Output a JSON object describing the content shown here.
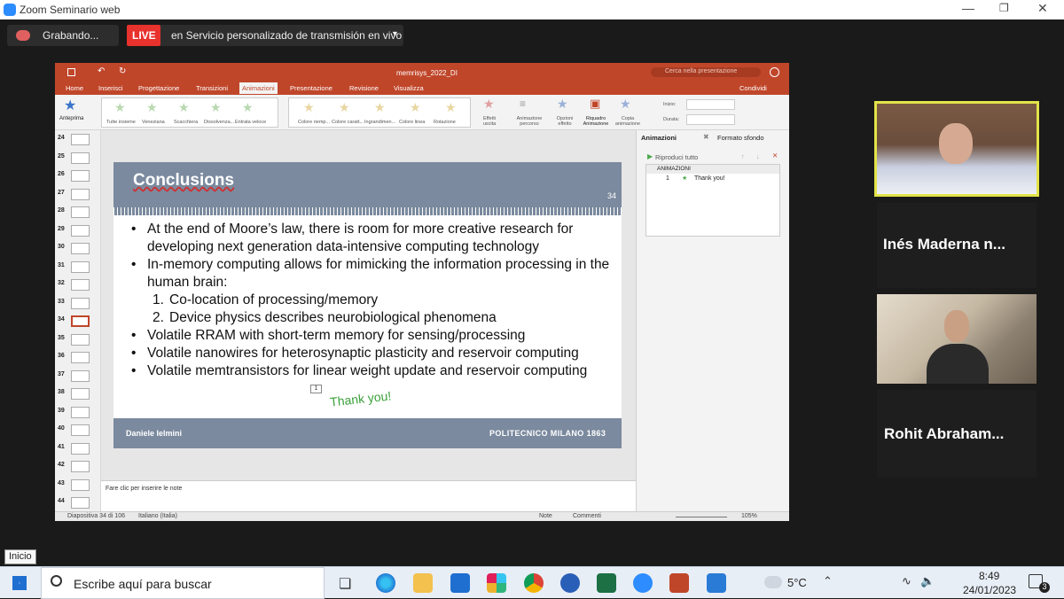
{
  "window": {
    "title": "Zoom Seminario web"
  },
  "zoom": {
    "recording": "Grabando...",
    "live_badge": "LIVE",
    "live_service": "en Servicio personalizado de transmisión en vivo"
  },
  "ppt": {
    "filename": "memrisys_2022_DI",
    "search_placeholder": "Cerca nella presentazione",
    "tabs": [
      "Home",
      "Inserisci",
      "Progettazione",
      "Transizioni",
      "Animazioni",
      "Presentazione",
      "Revisione",
      "Visualizza"
    ],
    "share": "Condividi",
    "ribbon": {
      "preview": "Anteprima",
      "effects": [
        "Tutte insieme",
        "Veneziana",
        "Scacchiera",
        "Dissolvenza...",
        "Entrata veloce"
      ],
      "emphasis": [
        "Colore riemp...",
        "Colore caratt...",
        "Ingrandimen...",
        "Colore linea",
        "Rotazione"
      ],
      "effect_opts": "Effetti uscita",
      "anim_path": "Animazione percorso",
      "options": "Opzioni effetto",
      "anim_pane": "Riquadro Animazione",
      "copy_anim": "Copia animazione",
      "start": "Inizio:",
      "duration": "Durata:"
    },
    "slide_numbers": [
      "24",
      "25",
      "26",
      "27",
      "28",
      "29",
      "30",
      "31",
      "32",
      "33",
      "34",
      "35",
      "36",
      "37",
      "38",
      "39",
      "40",
      "41",
      "42",
      "43",
      "44"
    ],
    "notes_placeholder": "Fare clic per inserire le note",
    "panel": {
      "tab1": "Animazioni",
      "tab2": "Formato sfondo",
      "play": "Riproduci tutto",
      "header": "ANIMAZIONI",
      "item_num": "1",
      "item_label": "Thank you!"
    },
    "status": {
      "slide": "Diapositiva 34 di 106",
      "lang": "Italiano (Italia)",
      "notes": "Note",
      "comments": "Commenti",
      "zoom": "105%"
    }
  },
  "slide": {
    "title": "Conclusions",
    "page_num": "34",
    "bullets": [
      "At the end of Moore’s law, there is room for more creative research for developing next generation data-intensive computing technology",
      "In-memory computing allows for mimicking the information processing in the human brain:"
    ],
    "subitems": [
      "Co-location of processing/memory",
      "Device physics describes neurobiological phenomena"
    ],
    "bullets2": [
      "Volatile RRAM with short-term memory for sensing/processing",
      "Volatile nanowires for heterosynaptic plasticity and reservoir computing",
      "Volatile memtransistors for linear weight update and reservoir computing"
    ],
    "anim_tag": "1",
    "thank_you": "Thank you!",
    "author": "Daniele Ielmini",
    "institution": "POLITECNICO MILANO 1863"
  },
  "participants": [
    {
      "name": "Inés Maderna n..."
    },
    {
      "name": "Rohit Abraham..."
    }
  ],
  "taskbar": {
    "tooltip": "Inicio",
    "search": "Escribe aquí para buscar",
    "temp": "5°C",
    "time": "8:49",
    "date": "24/01/2023",
    "notif": "3"
  }
}
